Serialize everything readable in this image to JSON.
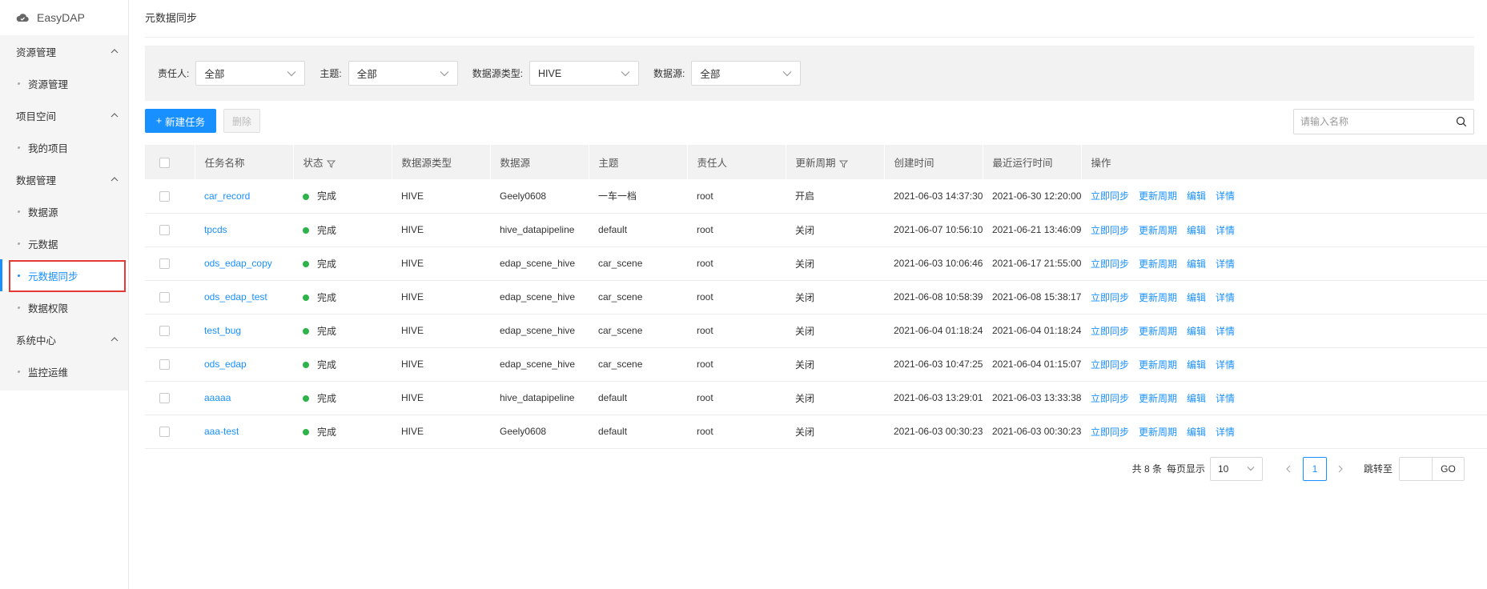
{
  "app": {
    "title": "EasyDAP"
  },
  "sidebar": {
    "groups": [
      {
        "label": "资源管理",
        "items": [
          "资源管理"
        ]
      },
      {
        "label": "项目空间",
        "items": [
          "我的项目"
        ]
      },
      {
        "label": "数据管理",
        "items": [
          "数据源",
          "元数据",
          "元数据同步",
          "数据权限"
        ]
      },
      {
        "label": "系统中心",
        "items": [
          "监控运维"
        ]
      }
    ]
  },
  "page": {
    "title": "元数据同步"
  },
  "filters": {
    "owner": {
      "label": "责任人:",
      "value": "全部"
    },
    "topic": {
      "label": "主题:",
      "value": "全部"
    },
    "source_type": {
      "label": "数据源类型:",
      "value": "HIVE"
    },
    "source": {
      "label": "数据源:",
      "value": "全部"
    }
  },
  "toolbar": {
    "new_task": "新建任务",
    "delete": "删除",
    "search_placeholder": "请输入名称"
  },
  "table": {
    "columns": [
      "任务名称",
      "状态",
      "数据源类型",
      "数据源",
      "主题",
      "责任人",
      "更新周期",
      "创建时间",
      "最近运行时间",
      "操作"
    ],
    "actions": [
      "立即同步",
      "更新周期",
      "编辑",
      "详情"
    ],
    "rows": [
      {
        "name": "car_record",
        "status": "完成",
        "type": "HIVE",
        "source": "Geely0608",
        "topic": "一车一档",
        "owner": "root",
        "cycle": "开启",
        "created": "2021-06-03 14:37:30",
        "last_run": "2021-06-30 12:20:00"
      },
      {
        "name": "tpcds",
        "status": "完成",
        "type": "HIVE",
        "source": "hive_datapipeline",
        "topic": "default",
        "owner": "root",
        "cycle": "关闭",
        "created": "2021-06-07 10:56:10",
        "last_run": "2021-06-21 13:46:09"
      },
      {
        "name": "ods_edap_copy",
        "status": "完成",
        "type": "HIVE",
        "source": "edap_scene_hive",
        "topic": "car_scene",
        "owner": "root",
        "cycle": "关闭",
        "created": "2021-06-03 10:06:46",
        "last_run": "2021-06-17 21:55:00"
      },
      {
        "name": "ods_edap_test",
        "status": "完成",
        "type": "HIVE",
        "source": "edap_scene_hive",
        "topic": "car_scene",
        "owner": "root",
        "cycle": "关闭",
        "created": "2021-06-08 10:58:39",
        "last_run": "2021-06-08 15:38:17"
      },
      {
        "name": "test_bug",
        "status": "完成",
        "type": "HIVE",
        "source": "edap_scene_hive",
        "topic": "car_scene",
        "owner": "root",
        "cycle": "关闭",
        "created": "2021-06-04 01:18:24",
        "last_run": "2021-06-04 01:18:24"
      },
      {
        "name": "ods_edap",
        "status": "完成",
        "type": "HIVE",
        "source": "edap_scene_hive",
        "topic": "car_scene",
        "owner": "root",
        "cycle": "关闭",
        "created": "2021-06-03 10:47:25",
        "last_run": "2021-06-04 01:15:07"
      },
      {
        "name": "aaaaa",
        "status": "完成",
        "type": "HIVE",
        "source": "hive_datapipeline",
        "topic": "default",
        "owner": "root",
        "cycle": "关闭",
        "created": "2021-06-03 13:29:01",
        "last_run": "2021-06-03 13:33:38"
      },
      {
        "name": "aaa-test",
        "status": "完成",
        "type": "HIVE",
        "source": "Geely0608",
        "topic": "default",
        "owner": "root",
        "cycle": "关闭",
        "created": "2021-06-03 00:30:23",
        "last_run": "2021-06-03 00:30:23"
      }
    ]
  },
  "pagination": {
    "total": "共 8 条",
    "per_page_label": "每页显示",
    "page_size": "10",
    "current_page": "1",
    "jump_label": "跳转至",
    "go": "GO"
  },
  "colors": {
    "accent": "#1890ff",
    "status_ok": "#2db34a",
    "highlight": "#e53935"
  }
}
